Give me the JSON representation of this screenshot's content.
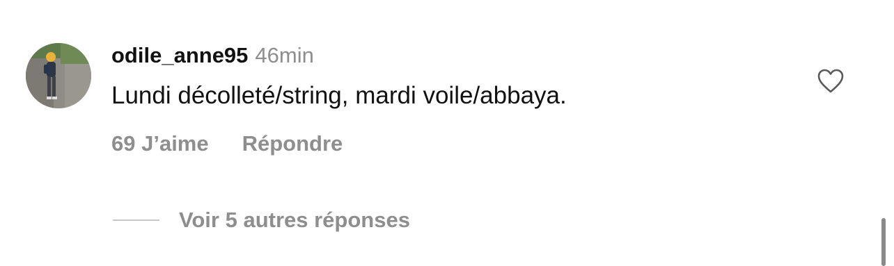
{
  "comment": {
    "username": "odile_anne95",
    "timestamp": "46min",
    "text": "Lundi décolleté/string, mardi voile/abbaya.",
    "likes_label": "69 J’aime",
    "reply_label": "Répondre",
    "like_icon": "heart-outline-icon",
    "avatar_icon": "user-avatar"
  },
  "replies": {
    "view_more_label": "Voir 5 autres réponses"
  },
  "colors": {
    "primary_text": "#111111",
    "secondary_text": "#8e8e8e",
    "divider": "#c7c7c7"
  }
}
